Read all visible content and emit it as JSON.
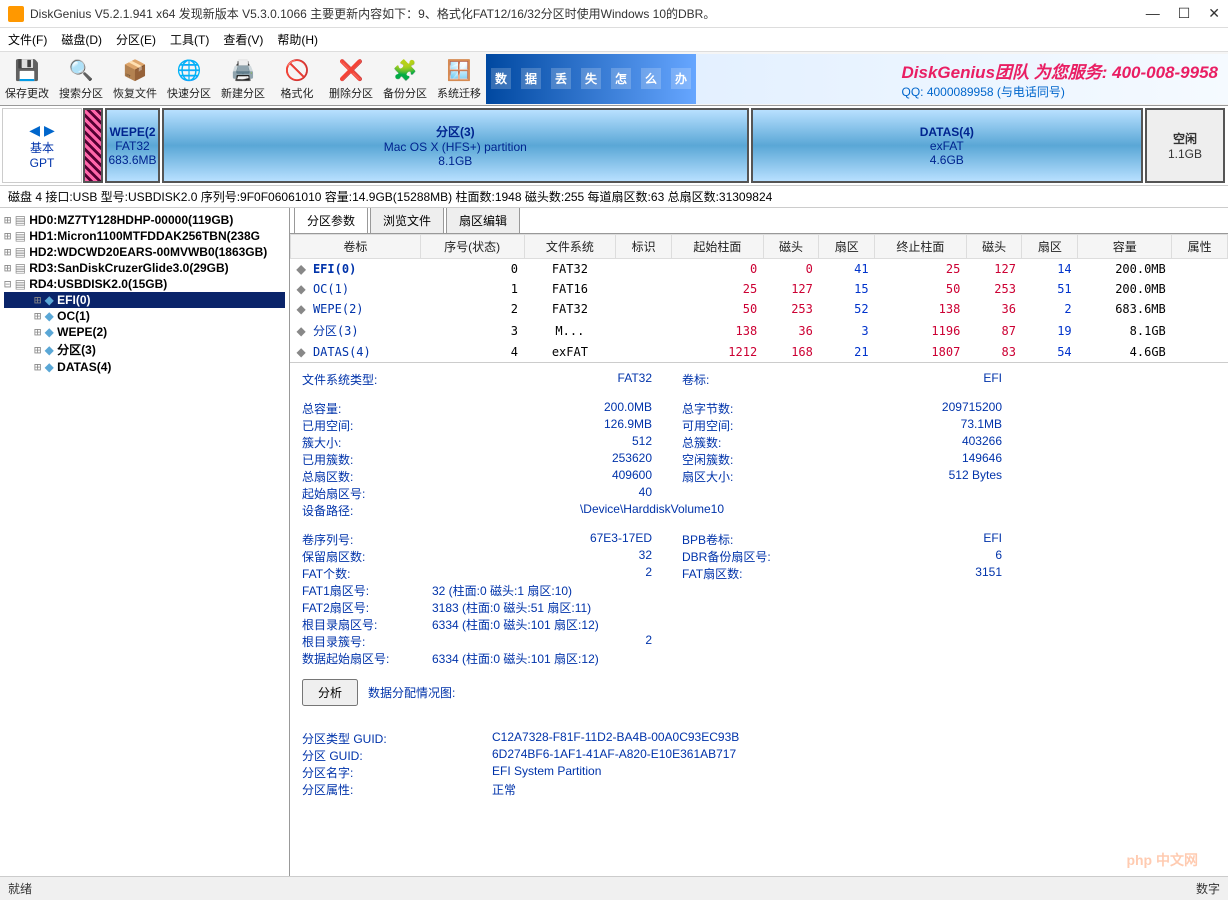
{
  "title": "DiskGenius V5.2.1.941 x64   发现新版本 V5.3.0.1066 主要更新内容如下：9、格式化FAT12/16/32分区时使用Windows 10的DBR。",
  "menu": {
    "file": "文件(F)",
    "disk": "磁盘(D)",
    "partition": "分区(E)",
    "tools": "工具(T)",
    "view": "查看(V)",
    "help": "帮助(H)"
  },
  "toolbar": [
    {
      "icon": "💾",
      "label": "保存更改"
    },
    {
      "icon": "🔍",
      "label": "搜索分区"
    },
    {
      "icon": "📦",
      "label": "恢复文件"
    },
    {
      "icon": "🌐",
      "label": "快速分区"
    },
    {
      "icon": "🖨️",
      "label": "新建分区"
    },
    {
      "icon": "🚫",
      "label": "格式化"
    },
    {
      "icon": "❌",
      "label": "删除分区"
    },
    {
      "icon": "🧩",
      "label": "备份分区"
    },
    {
      "icon": "🪟",
      "label": "系统迁移"
    }
  ],
  "banner": {
    "chars": [
      "数",
      "据",
      "丢",
      "失",
      "怎",
      "么",
      "办"
    ],
    "promo": "DiskGenius团队 为您服务: 400-008-9958",
    "qq": "QQ: 4000089958 (与电话同号)"
  },
  "diskmap": {
    "base": "基本",
    "gpt": "GPT",
    "parts": [
      {
        "cls": "small",
        "l1": "",
        "l2": "",
        "l3": ""
      },
      {
        "cls": "wepe",
        "l1": "WEPE(2",
        "l2": "FAT32",
        "l3": "683.6MB"
      },
      {
        "cls": "main",
        "l1": "分区(3)",
        "l2": "Mac OS X (HFS+) partition",
        "l3": "8.1GB"
      },
      {
        "cls": "datas",
        "l1": "DATAS(4)",
        "l2": "exFAT",
        "l3": "4.6GB"
      },
      {
        "cls": "free",
        "l1": "空闲",
        "l2": "",
        "l3": "1.1GB"
      }
    ]
  },
  "diskinfo": "磁盘 4 接口:USB  型号:USBDISK2.0  序列号:9F0F06061010  容量:14.9GB(15288MB)  柱面数:1948  磁头数:255  每道扇区数:63  总扇区数:31309824",
  "tree": {
    "disks": [
      "HD0:MZ7TY128HDHP-00000(119GB)",
      "HD1:Micron1100MTFDDAK256TBN(238G",
      "HD2:WDCWD20EARS-00MVWB0(1863GB)",
      "RD3:SanDiskCruzerGlide3.0(29GB)",
      "RD4:USBDISK2.0(15GB)"
    ],
    "children": [
      {
        "name": "EFI(0)",
        "sel": true
      },
      {
        "name": "OC(1)",
        "sel": false
      },
      {
        "name": "WEPE(2)",
        "sel": false
      },
      {
        "name": "分区(3)",
        "sel": false
      },
      {
        "name": "DATAS(4)",
        "sel": false
      }
    ]
  },
  "tabs": {
    "t1": "分区参数",
    "t2": "浏览文件",
    "t3": "扇区编辑"
  },
  "table": {
    "headers": [
      "卷标",
      "序号(状态)",
      "文件系统",
      "标识",
      "起始柱面",
      "磁头",
      "扇区",
      "终止柱面",
      "磁头",
      "扇区",
      "容量",
      "属性"
    ],
    "rows": [
      {
        "name": "EFI(0)",
        "seq": "0",
        "fs": "FAT32",
        "id": "",
        "sc": "0",
        "sh": "0",
        "ss": "41",
        "ec": "25",
        "eh": "127",
        "es": "14",
        "cap": "200.0MB",
        "attr": ""
      },
      {
        "name": "OC(1)",
        "seq": "1",
        "fs": "FAT16",
        "id": "",
        "sc": "25",
        "sh": "127",
        "ss": "15",
        "ec": "50",
        "eh": "253",
        "es": "51",
        "cap": "200.0MB",
        "attr": ""
      },
      {
        "name": "WEPE(2)",
        "seq": "2",
        "fs": "FAT32",
        "id": "",
        "sc": "50",
        "sh": "253",
        "ss": "52",
        "ec": "138",
        "eh": "36",
        "es": "2",
        "cap": "683.6MB",
        "attr": ""
      },
      {
        "name": "分区(3)",
        "seq": "3",
        "fs": "M...",
        "id": "",
        "sc": "138",
        "sh": "36",
        "ss": "3",
        "ec": "1196",
        "eh": "87",
        "es": "19",
        "cap": "8.1GB",
        "attr": ""
      },
      {
        "name": "DATAS(4)",
        "seq": "4",
        "fs": "exFAT",
        "id": "",
        "sc": "1212",
        "sh": "168",
        "ss": "21",
        "ec": "1807",
        "eh": "83",
        "es": "54",
        "cap": "4.6GB",
        "attr": ""
      }
    ]
  },
  "details": {
    "fs_type_l": "文件系统类型:",
    "fs_type_v": "FAT32",
    "vol_l": "卷标:",
    "vol_v": "EFI",
    "total_l": "总容量:",
    "total_v": "200.0MB",
    "bytes_l": "总字节数:",
    "bytes_v": "209715200",
    "used_l": "已用空间:",
    "used_v": "126.9MB",
    "free_l": "可用空间:",
    "free_v": "73.1MB",
    "cluster_l": "簇大小:",
    "cluster_v": "512",
    "totcl_l": "总簇数:",
    "totcl_v": "403266",
    "usedcl_l": "已用簇数:",
    "usedcl_v": "253620",
    "freecl_l": "空闲簇数:",
    "freecl_v": "149646",
    "totsec_l": "总扇区数:",
    "totsec_v": "409600",
    "secsize_l": "扇区大小:",
    "secsize_v": "512 Bytes",
    "startsec_l": "起始扇区号:",
    "startsec_v": "40",
    "devpath_l": "设备路径:",
    "devpath_v": "\\Device\\HarddiskVolume10",
    "serial_l": "卷序列号:",
    "serial_v": "67E3-17ED",
    "bpb_l": "BPB卷标:",
    "bpb_v": "EFI",
    "resv_l": "保留扇区数:",
    "resv_v": "32",
    "dbrbak_l": "DBR备份扇区号:",
    "dbrbak_v": "6",
    "fatcnt_l": "FAT个数:",
    "fatcnt_v": "2",
    "fatsec_l": "FAT扇区数:",
    "fatsec_v": "3151",
    "fat1_l": "FAT1扇区号:",
    "fat1_v": "32 (柱面:0 磁头:1 扇区:10)",
    "fat2_l": "FAT2扇区号:",
    "fat2_v": "3183 (柱面:0 磁头:51 扇区:11)",
    "rootsec_l": "根目录扇区号:",
    "rootsec_v": "6334 (柱面:0 磁头:101 扇区:12)",
    "rootcl_l": "根目录簇号:",
    "rootcl_v": "2",
    "datastart_l": "数据起始扇区号:",
    "datastart_v": "6334 (柱面:0 磁头:101 扇区:12)",
    "analyze_btn": "分析",
    "analyze_lbl": "数据分配情况图:",
    "pt_guid_l": "分区类型 GUID:",
    "pt_guid_v": "C12A7328-F81F-11D2-BA4B-00A0C93EC93B",
    "p_guid_l": "分区 GUID:",
    "p_guid_v": "6D274BF6-1AF1-41AF-A820-E10E361AB717",
    "pname_l": "分区名字:",
    "pname_v": "EFI System Partition",
    "pattr_l": "分区属性:",
    "pattr_v": "正常"
  },
  "status": {
    "left": "就绪",
    "right": "数字"
  },
  "watermark": "php 中文网"
}
